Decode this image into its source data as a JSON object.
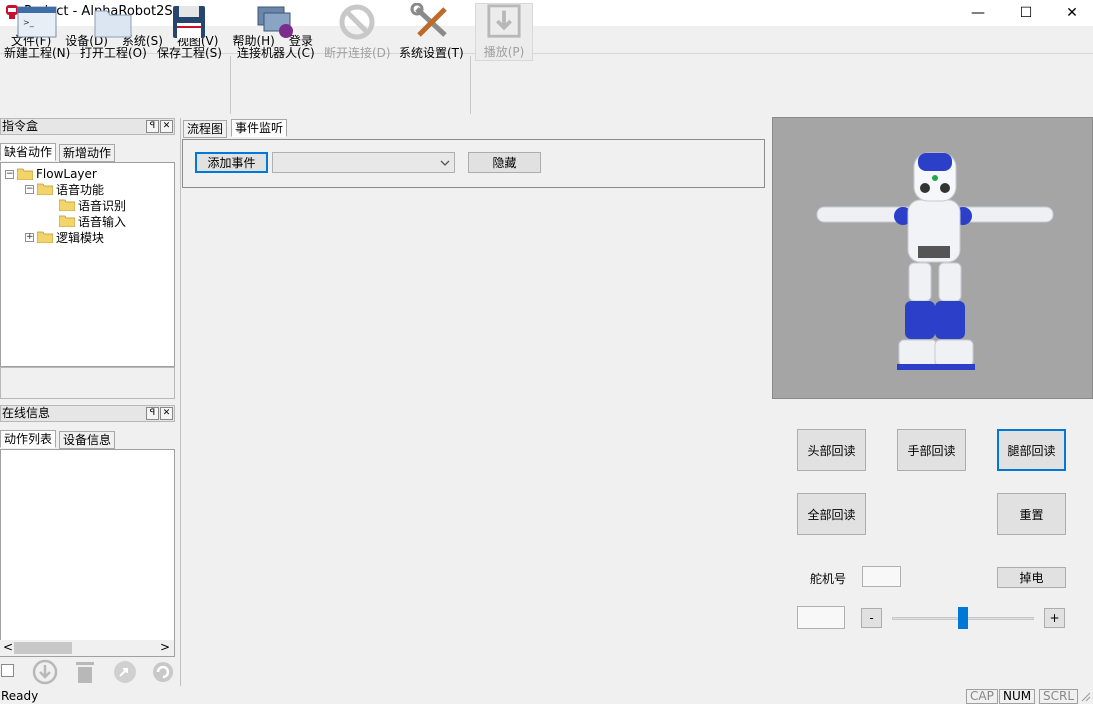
{
  "window": {
    "title": "Project - AlphaRobot2S",
    "minimize": "—",
    "maximize": "☐",
    "close": "✕"
  },
  "menu": [
    "文件(F)",
    "设备(D)",
    "系统(S)",
    "视图(V)",
    "帮助(H)",
    "登录"
  ],
  "toolbar": {
    "new_project": "新建工程(N)",
    "open_project": "打开工程(O)",
    "save_project": "保存工程(S)",
    "connect_robot": "连接机器人(C)",
    "disconnect": "断开连接(D)",
    "settings": "系统设置(T)",
    "play": "播放(P)"
  },
  "command_box": {
    "title": "指令盒",
    "pin": "ꟼ",
    "close": "✕",
    "tabs": [
      "缺省动作",
      "新增动作"
    ],
    "tree": [
      {
        "label": "FlowLayer",
        "exp": "−"
      },
      {
        "label": "语音功能",
        "exp": "−"
      },
      {
        "label": "语音识别"
      },
      {
        "label": "语音输入"
      },
      {
        "label": "逻辑模块",
        "exp": "+"
      }
    ]
  },
  "online_info": {
    "title": "在线信息",
    "pin": "ꟼ",
    "close": "✕",
    "tabs": [
      "动作列表",
      "设备信息"
    ],
    "scroll_left": "<",
    "scroll_right": ">"
  },
  "main": {
    "tabs": [
      "流程图",
      "事件监听"
    ],
    "add_event": "添加事件",
    "event_select": "",
    "hide": "隐藏"
  },
  "robot_panel": {
    "head_readback": "头部回读",
    "hand_readback": "手部回读",
    "leg_readback": "腿部回读",
    "all_readback": "全部回读",
    "reset": "重置",
    "servo_label": "舵机号",
    "servo_value": "",
    "power_off": "掉电",
    "angle_value": "",
    "minus": "-",
    "plus": "+",
    "slider_value": 0.5
  },
  "status": {
    "text": "Ready",
    "cap": "CAP",
    "num": "NUM",
    "scrl": "SCRL"
  }
}
